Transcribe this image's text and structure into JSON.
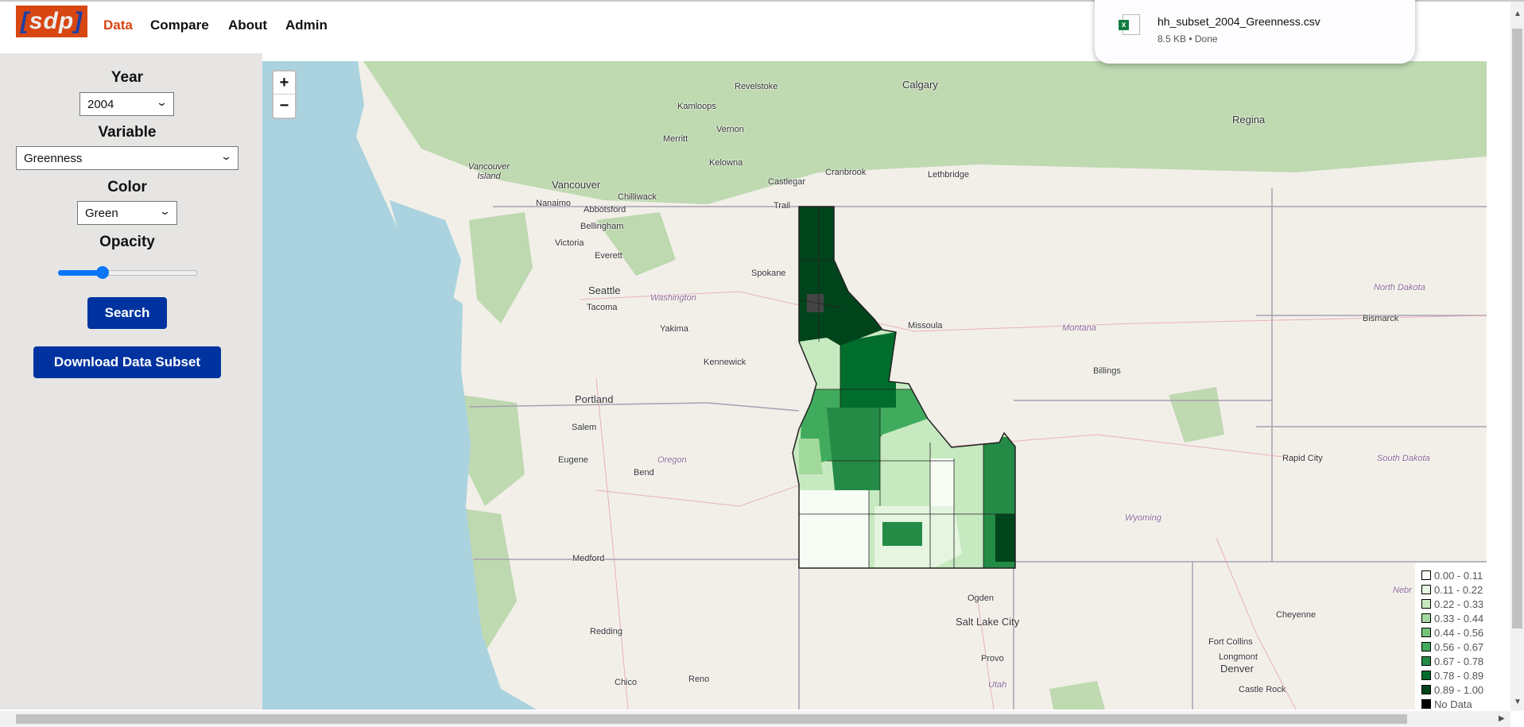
{
  "header": {
    "logo_text": "sdp",
    "nav": [
      {
        "label": "Data",
        "active": true
      },
      {
        "label": "Compare"
      },
      {
        "label": "About"
      },
      {
        "label": "Admin"
      }
    ]
  },
  "sidebar": {
    "year_label": "Year",
    "year_value": "2004",
    "variable_label": "Variable",
    "variable_value": "Greenness",
    "color_label": "Color",
    "color_value": "Green",
    "opacity_label": "Opacity",
    "opacity_value": 0.3,
    "search_label": "Search",
    "download_label": "Download Data Subset",
    "button_color": "#0033a0"
  },
  "download": {
    "filename": "hh_subset_2004_Greenness.csv",
    "meta": "8.5 KB • Done",
    "icon": "excel-file-icon"
  },
  "map": {
    "zoom_in": "+",
    "zoom_out": "−",
    "labels": [
      "Calgary",
      "Revelstoke",
      "Kamloops",
      "Vernon",
      "Merritt",
      "Kelowna",
      "Regina",
      "Vancouver Island",
      "Vancouver",
      "Chilliwack",
      "Castlegar",
      "Cranbrook",
      "Lethbridge",
      "Nanaimo",
      "Abbotsford",
      "Trail",
      "Bellingham",
      "Victoria",
      "Everett",
      "Seattle",
      "Tacoma",
      "Washington",
      "Spokane",
      "Missoula",
      "North Dakota",
      "Bismarck",
      "Yakima",
      "Montana",
      "Kennewick",
      "Billings",
      "Portland",
      "Salem",
      "Oregon",
      "Rapid City",
      "South Dakota",
      "Eugene",
      "Bend",
      "Wyoming",
      "Medford",
      "Nebr",
      "Ogden",
      "Cheyenne",
      "Salt Lake City",
      "Redding",
      "Fort Collins",
      "Longmont",
      "Provo",
      "Denver",
      "Utah",
      "Castle Rock",
      "Chico",
      "Reno"
    ]
  },
  "legend": {
    "items": [
      {
        "label": "0.00 - 0.11",
        "color": "#f7fcf5"
      },
      {
        "label": "0.11 - 0.22",
        "color": "#e5f5e0"
      },
      {
        "label": "0.22 - 0.33",
        "color": "#c7e9c0"
      },
      {
        "label": "0.33 - 0.44",
        "color": "#a1d99b"
      },
      {
        "label": "0.44 - 0.56",
        "color": "#74c476"
      },
      {
        "label": "0.56 - 0.67",
        "color": "#41ab5d"
      },
      {
        "label": "0.67 - 0.78",
        "color": "#238b45"
      },
      {
        "label": "0.78 - 0.89",
        "color": "#006d2c"
      },
      {
        "label": "0.89 - 1.00",
        "color": "#00441b"
      },
      {
        "label": "No Data",
        "color": "#000000"
      }
    ]
  }
}
